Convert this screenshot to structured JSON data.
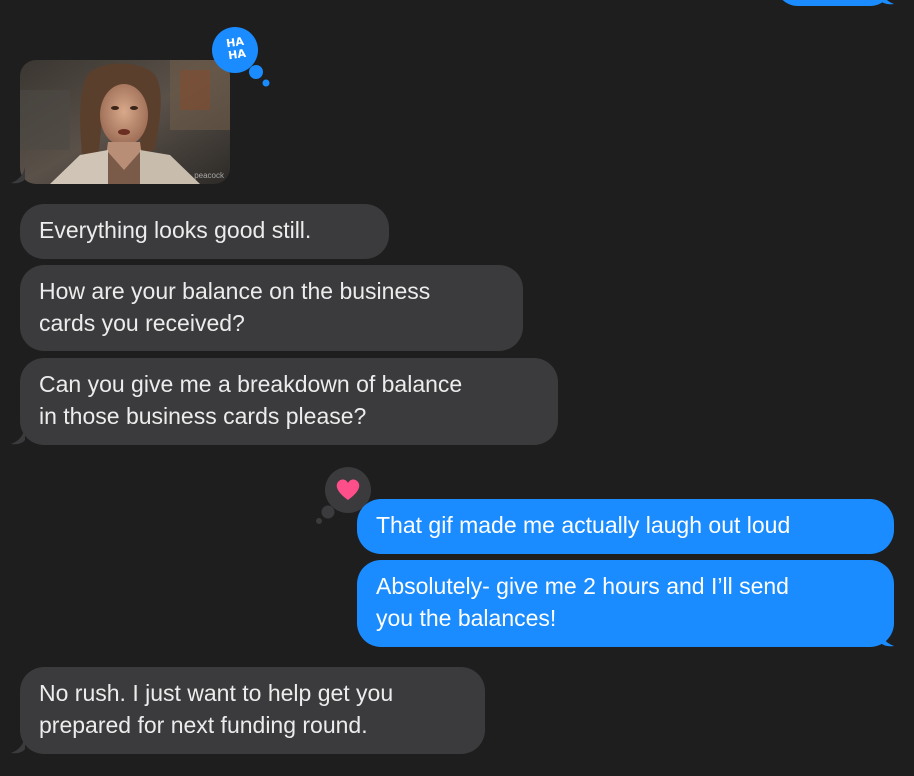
{
  "conversation": {
    "gif_watermark": "peacock",
    "messages": [
      {
        "direction": "incoming",
        "text": "Everything looks good still."
      },
      {
        "direction": "incoming",
        "text": "How are your balance on the business\ncards you received?"
      },
      {
        "direction": "incoming",
        "text": "Can you give me a breakdown of balance\nin those business cards please?"
      },
      {
        "direction": "outgoing",
        "text": "That gif made me actually laugh out loud"
      },
      {
        "direction": "outgoing",
        "text": "Absolutely- give me 2 hours and I’ll send\nyou the balances!"
      },
      {
        "direction": "incoming",
        "text": "No rush. I just want to help get you\nprepared for next funding round."
      }
    ],
    "tapbacks": {
      "gif": {
        "type": "haha",
        "line1": "HA",
        "line2": "HA",
        "color": "#1a8cff"
      },
      "outgoing_first": {
        "type": "heart-icon",
        "color": "#ff4f8b"
      }
    }
  },
  "colors": {
    "background": "#1e1e1e",
    "incoming_bubble": "#3b3b3d",
    "outgoing_bubble": "#1a8cff"
  }
}
